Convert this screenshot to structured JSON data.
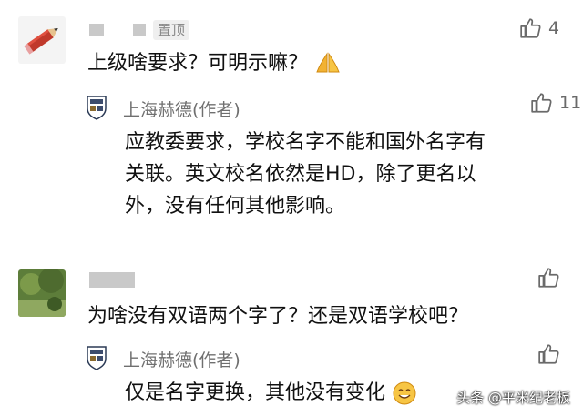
{
  "comments": [
    {
      "pinned_label": "置顶",
      "text": "上级啥要求？可明示嘛？",
      "likes": "4",
      "reply": {
        "author": "上海赫德(作者)",
        "likes": "11",
        "lines": [
          "应教委要求，学校名字不能和国外名字有",
          "关联。英文校名依然是HD，除了更名以",
          "外，没有任何其他影响。"
        ]
      }
    },
    {
      "text": "为啥没有双语两个字了？还是双语学校吧？",
      "likes": "",
      "reply": {
        "author": "上海赫德(作者)",
        "likes": "",
        "lines": [
          "仅是名字更换，其他没有变化"
        ]
      }
    }
  ],
  "watermark": "头条 @平米纪老板",
  "icons": {
    "like": "thumbs-up-icon",
    "avatar1": "pencil-avatar-icon",
    "school": "school-crest-icon",
    "pray": "praying-hands-emoji",
    "smile": "smiling-emoji"
  }
}
